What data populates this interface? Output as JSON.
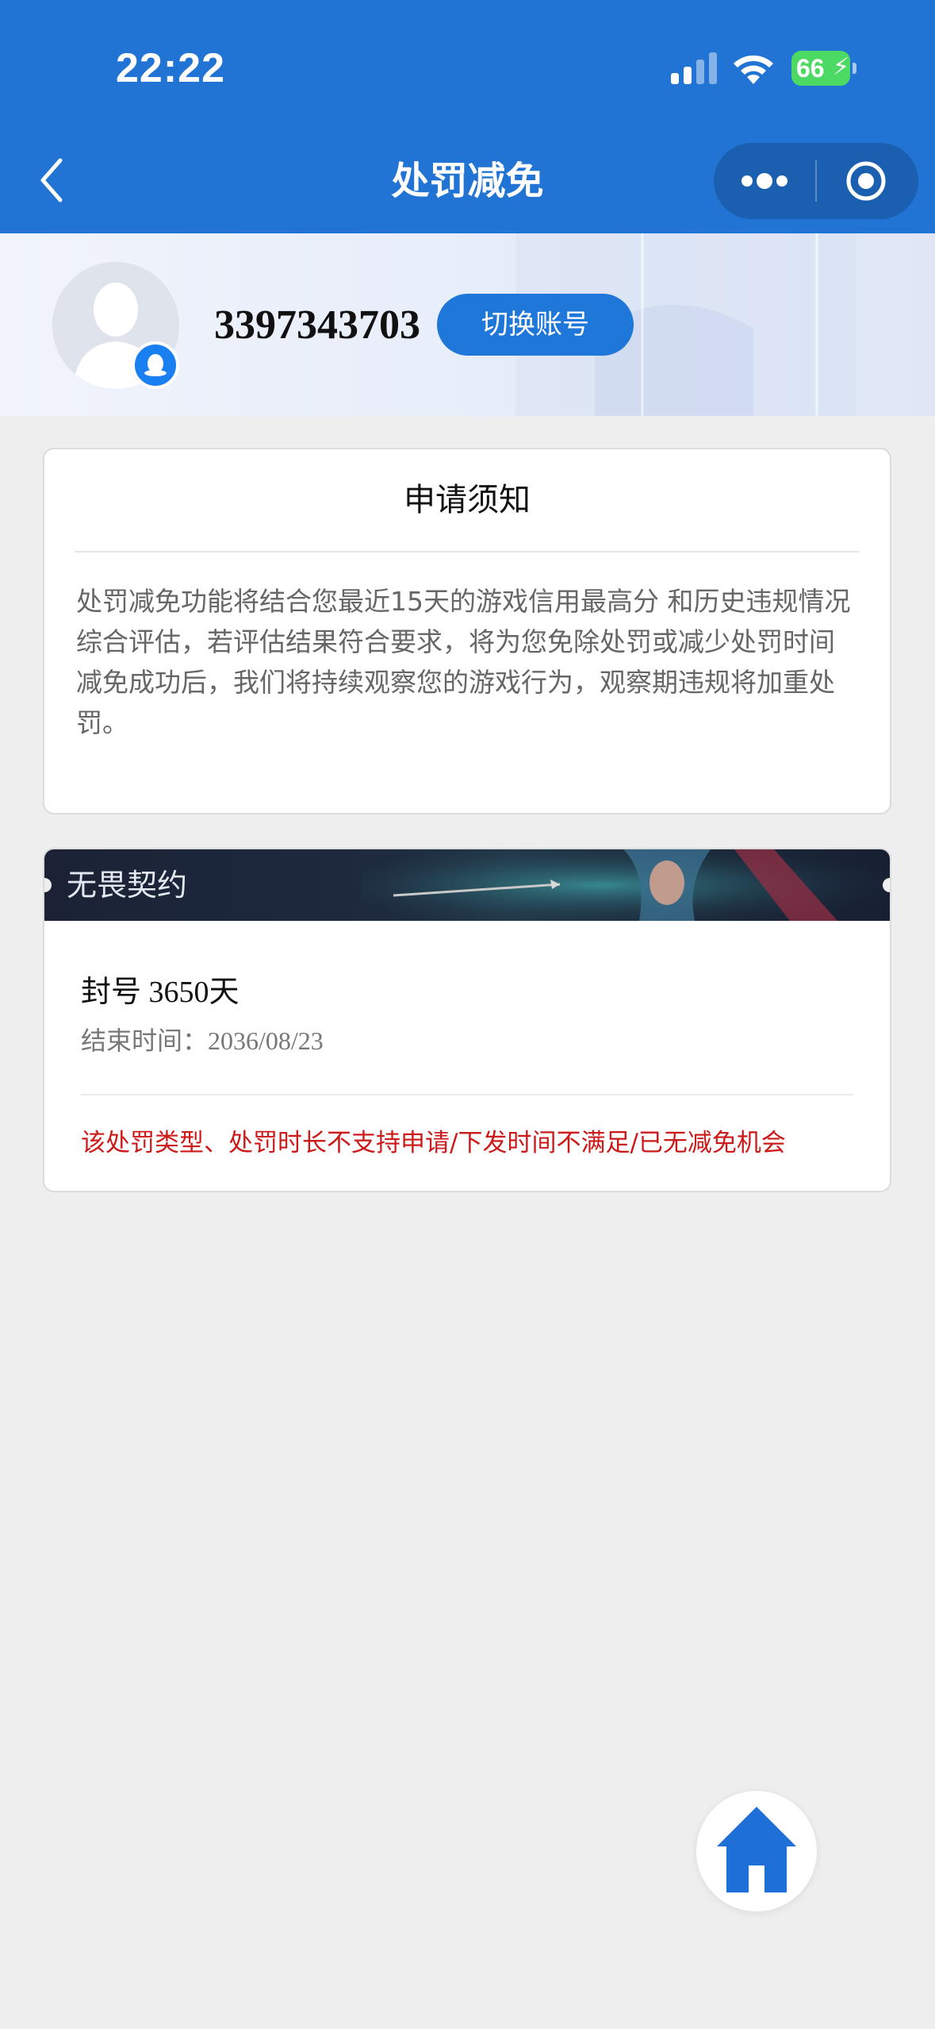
{
  "status_bar": {
    "time": "22:22",
    "battery_level": "66",
    "signal_icon": "cellular-signal-icon",
    "wifi_icon": "wifi-icon",
    "battery_icon": "battery-charging-icon"
  },
  "nav": {
    "title": "处罚减免",
    "back_icon": "chevron-left-icon",
    "more_icon": "more-dots-icon",
    "close_icon": "target-circle-icon"
  },
  "profile": {
    "account_id": "3397343703",
    "switch_label": "切换账号",
    "avatar_icon": "default-avatar-icon",
    "badge_icon": "qq-penguin-icon"
  },
  "notice": {
    "title": "申请须知",
    "paragraphs": [
      "处罚减免功能将结合您最近15天的游戏信用最高分 和历史违规情况综合评估，若评估结果符合要求，将为您免除处罚或减少处罚时间",
      "减免成功后，我们将持续观察您的游戏行为，观察期违规将加重处罚。"
    ]
  },
  "penalty": {
    "game_name": "无畏契约",
    "type": "封号 3650天",
    "end_time": "结束时间：2036/08/23",
    "note": "该处罚类型、处罚时长不支持申请/下发时间不满足/已无减免机会"
  },
  "home_button": {
    "icon": "home-icon"
  },
  "colors": {
    "primary": "#2174d4",
    "button": "#1f77da",
    "warning": "#cc1a1a",
    "background": "#eeeeee"
  }
}
